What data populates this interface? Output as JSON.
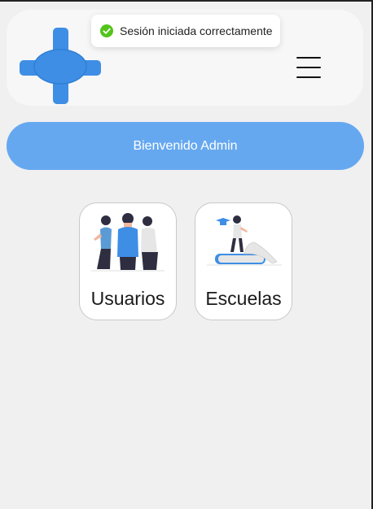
{
  "header": {
    "logo_icon": "medical-cross-logo",
    "menu_icon": "hamburger-menu-icon"
  },
  "toast": {
    "icon": "check-circle-icon",
    "message": "Sesión iniciada correctamente",
    "status_color": "#52c41a"
  },
  "welcome": {
    "text": "Bienvenido Admin"
  },
  "cards": [
    {
      "label": "Usuarios",
      "icon": "users-illustration"
    },
    {
      "label": "Escuelas",
      "icon": "school-illustration"
    }
  ],
  "colors": {
    "brand_blue": "#3e8ee5",
    "banner_blue": "#66a8f0",
    "background": "#f0f0f0"
  }
}
